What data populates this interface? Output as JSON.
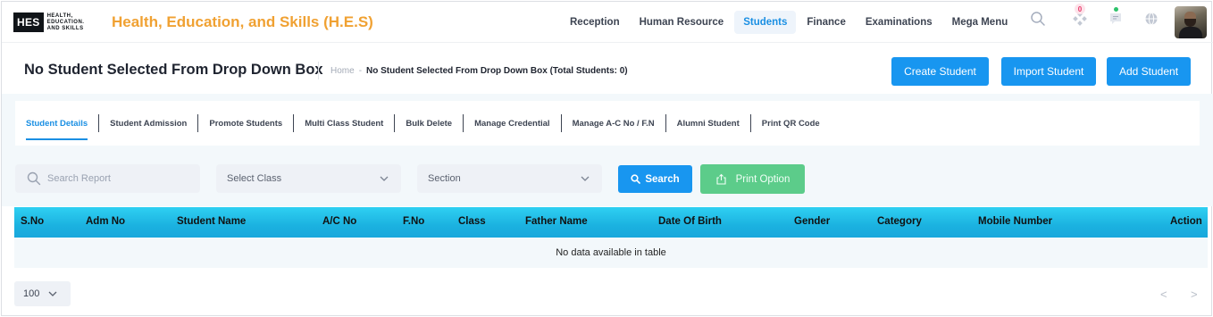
{
  "logo": {
    "mark": "HES",
    "line1": "HEALTH,",
    "line2": "EDUCATION.",
    "line3": "AND SKILLS"
  },
  "app_title": "Health, Education, and Skills (H.E.S)",
  "nav": [
    {
      "label": "Reception"
    },
    {
      "label": "Human Resource"
    },
    {
      "label": "Students",
      "active": true
    },
    {
      "label": "Finance"
    },
    {
      "label": "Examinations"
    },
    {
      "label": "Mega Menu"
    }
  ],
  "notifications": {
    "count": "0"
  },
  "page": {
    "title": "No Student Selected From Drop Down Box",
    "breadcrumb_home": "Home",
    "breadcrumb_dash": "-",
    "breadcrumb_current": "No Student Selected From Drop Down Box (Total Students: 0)"
  },
  "actions": {
    "create": "Create Student",
    "import": "Import Student",
    "add": "Add Student"
  },
  "tabs": [
    {
      "label": "Student Details",
      "active": true
    },
    {
      "label": "Student Admission"
    },
    {
      "label": "Promote Students"
    },
    {
      "label": "Multi Class Student"
    },
    {
      "label": "Bulk Delete"
    },
    {
      "label": "Manage Credential"
    },
    {
      "label": "Manage A-C No / F.N"
    },
    {
      "label": "Alumni Student"
    },
    {
      "label": "Print QR Code"
    }
  ],
  "filters": {
    "search_placeholder": "Search Report",
    "class_select": "Select Class",
    "section_select": "Section",
    "search_button": "Search",
    "print_button": "Print Option"
  },
  "table": {
    "columns": [
      "S.No",
      "Adm No",
      "Student Name",
      "A/C No",
      "F.No",
      "Class",
      "Father Name",
      "Date Of Birth",
      "Gender",
      "Category",
      "Mobile Number",
      "Action"
    ],
    "empty_text": "No data available in table"
  },
  "footer": {
    "page_size": "100",
    "prev": "<",
    "next": ">"
  },
  "colors": {
    "primary": "#1896f0",
    "brand_orange": "#f0a132",
    "success": "#5ccc8a",
    "table_header": "#1fb8e6"
  }
}
